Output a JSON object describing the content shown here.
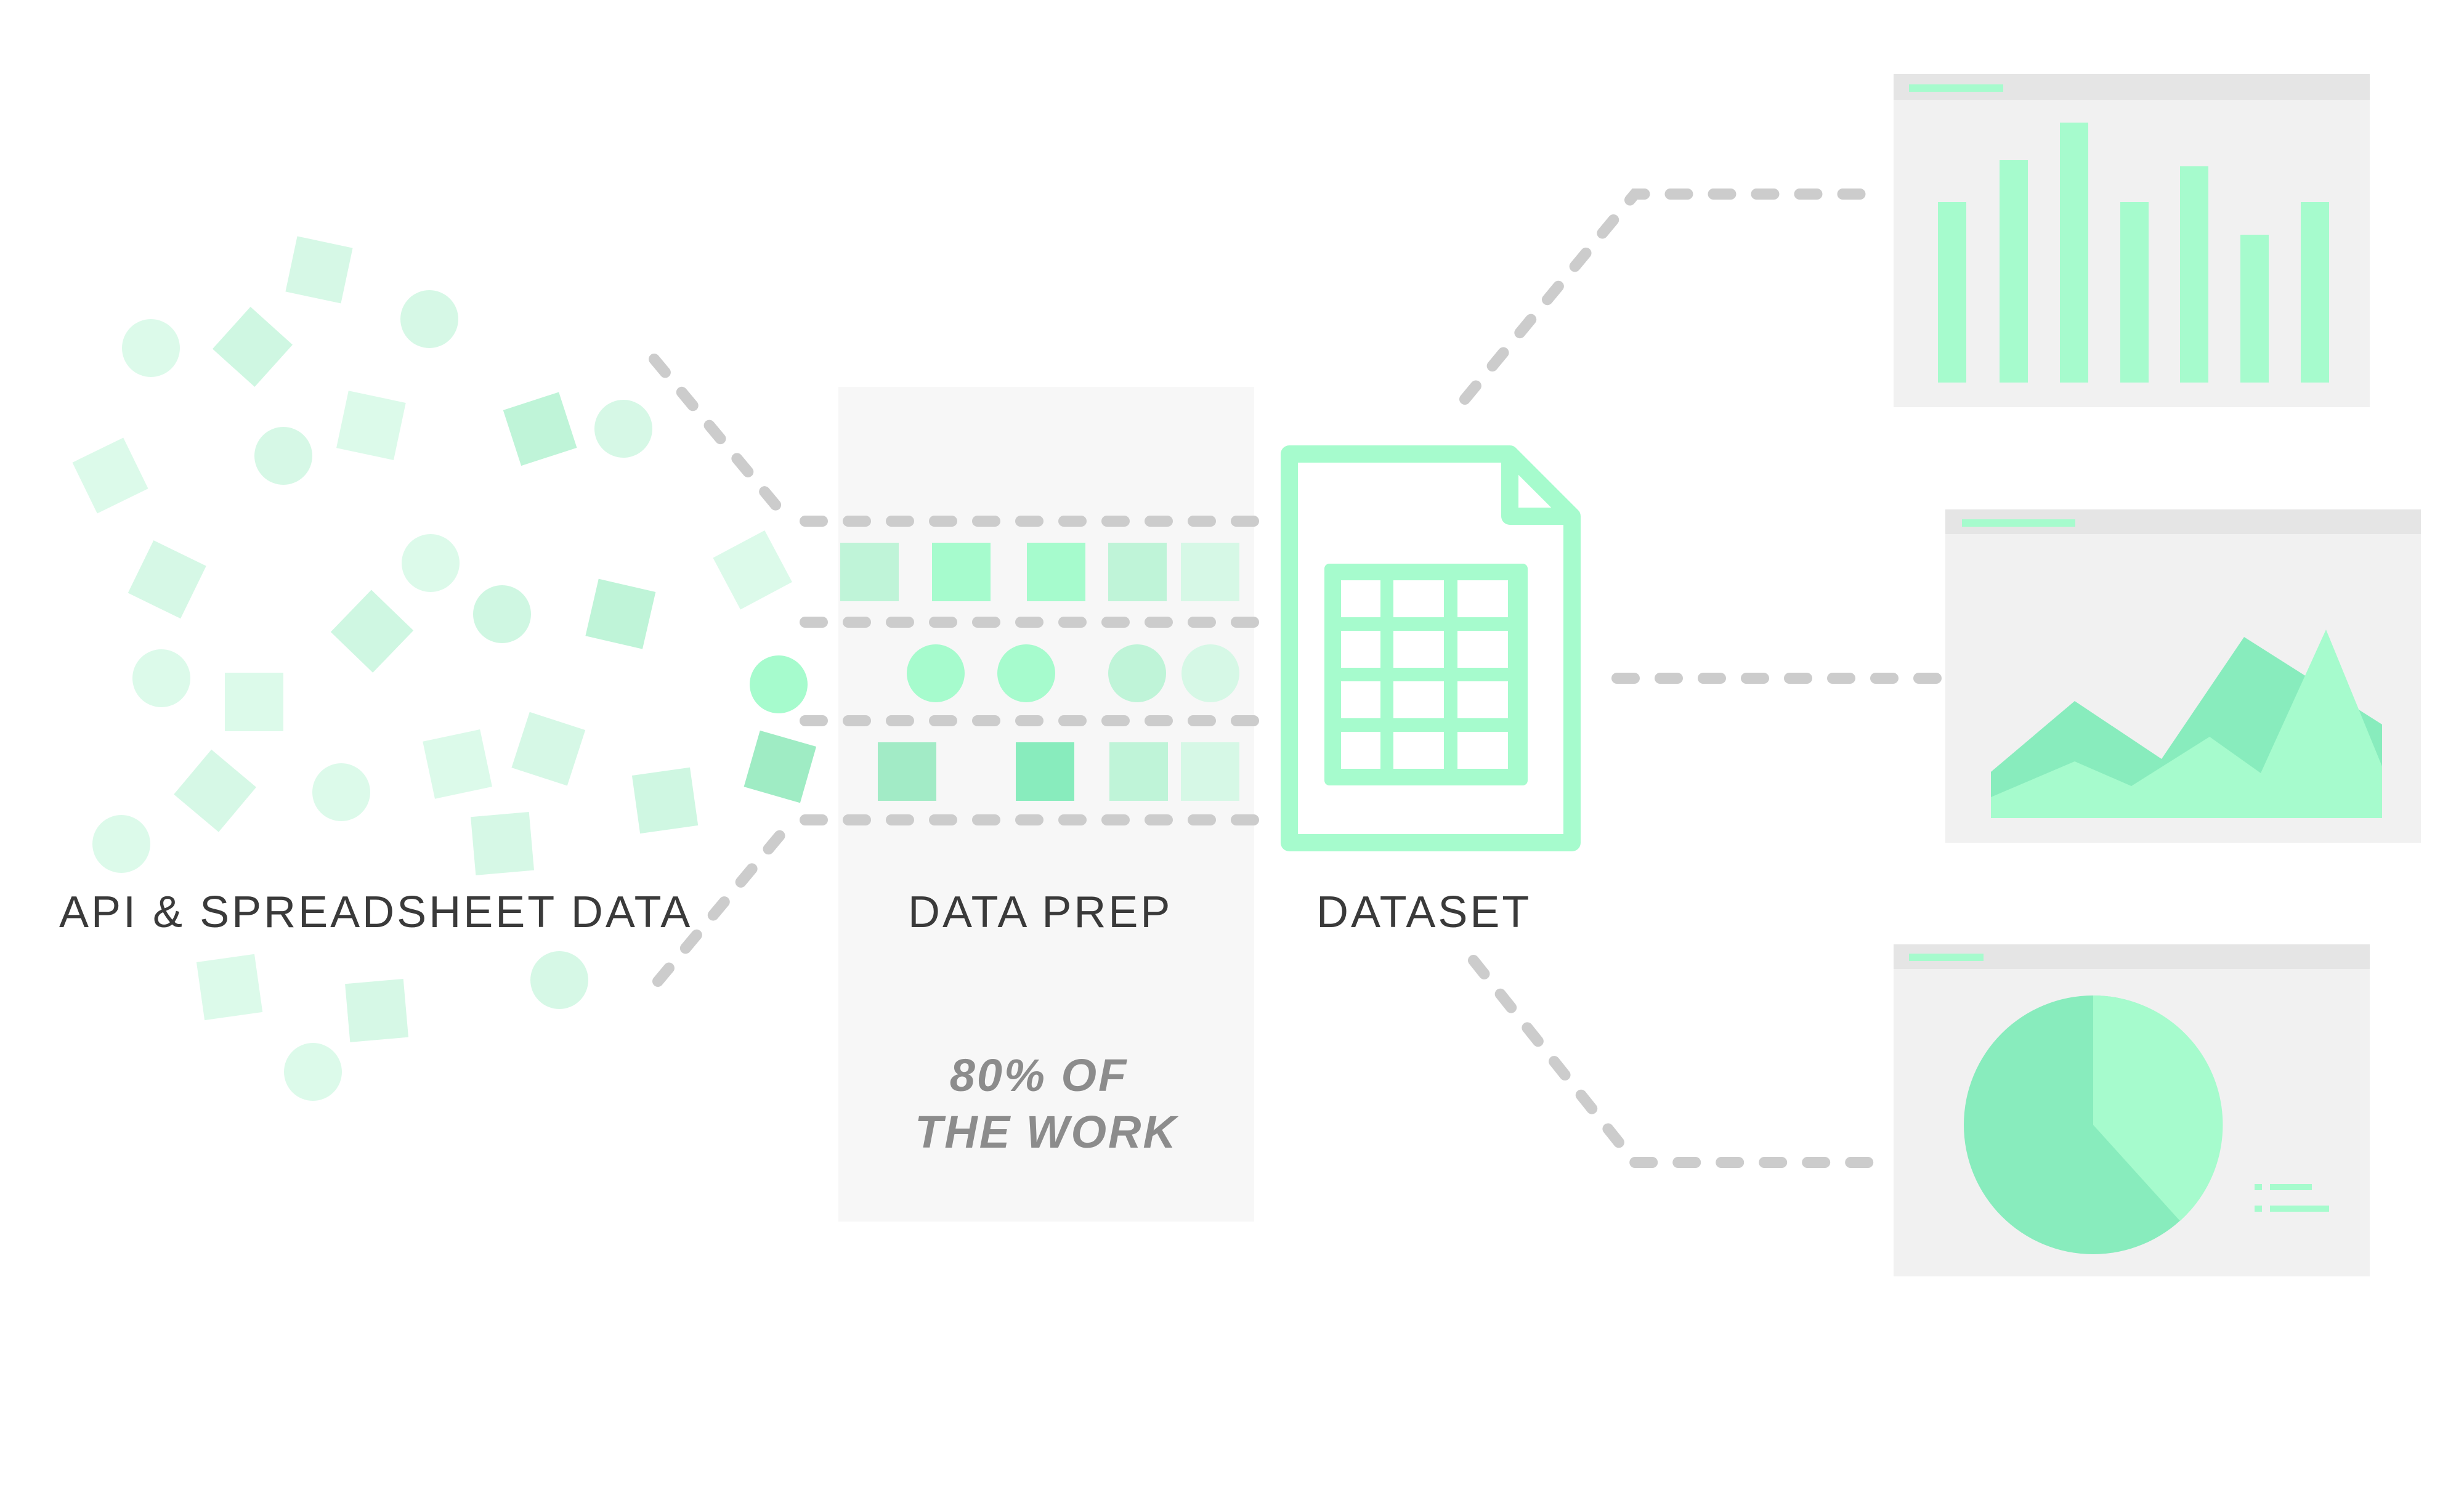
{
  "labels": {
    "source": "API & SPREADSHEET DATA",
    "prep": "DATA PREP",
    "dataset": "DATASET",
    "note_line1": "80% OF",
    "note_line2": "THE WORK"
  },
  "colors": {
    "accent": "#a6fbcd",
    "accent_dark": "#88ecbd",
    "light": "#d6f8e6",
    "panel": "#f7f7f7",
    "card": "#f1f1f1",
    "card_header": "#e5e5e5",
    "connector": "#cccccc",
    "text": "#3a3a3a",
    "note_text": "#8c8c8c"
  },
  "icons": {
    "dataset": "spreadsheet-document-icon",
    "bar_chart": "bar-chart-icon",
    "area_chart": "area-chart-icon",
    "pie_chart": "pie-chart-icon"
  }
}
